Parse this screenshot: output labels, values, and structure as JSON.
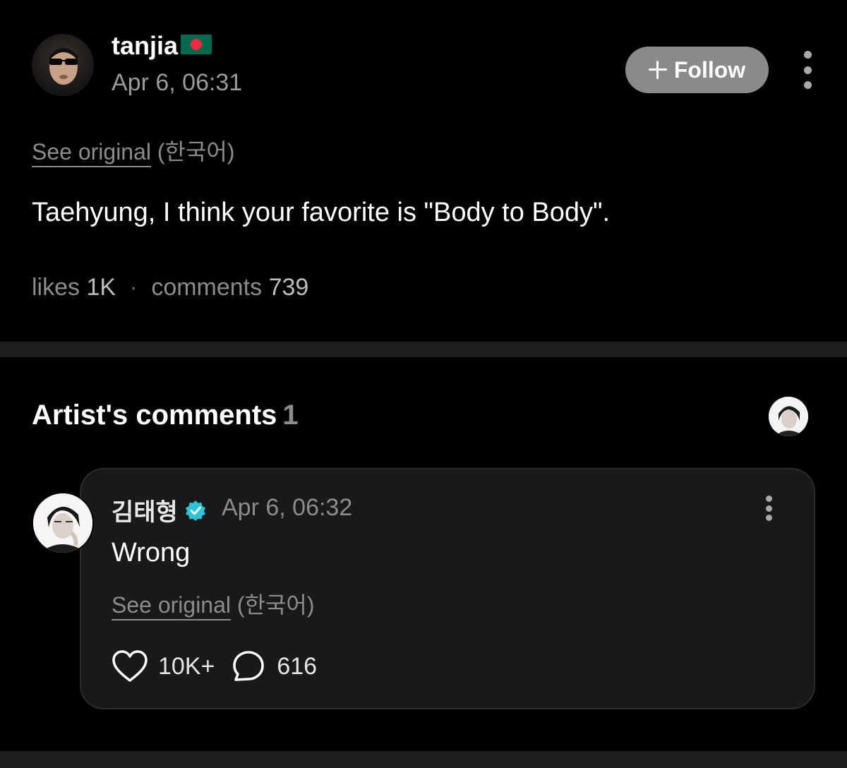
{
  "post": {
    "username": "tanjia",
    "flag": "bangladesh-flag-icon",
    "timestamp": "Apr 6, 06:31",
    "follow_label": "Follow",
    "see_original_label": "See original",
    "original_language": "(한국어)",
    "body": "Taehyung, I think your favorite is \"Body to Body\".",
    "stats": {
      "likes_label": "likes",
      "likes_value": "1K",
      "separator": "·",
      "comments_label": "comments",
      "comments_value": "739"
    }
  },
  "artist_comments": {
    "title": "Artist's comments",
    "count": "1",
    "comment": {
      "author": "김태형",
      "timestamp": "Apr 6, 06:32",
      "body": "Wrong",
      "see_original_label": "See original",
      "original_language": "(한국어)",
      "likes": "10K+",
      "replies": "616"
    }
  },
  "colors": {
    "background": "#000000",
    "card": "#191919",
    "follow_button": "#8a8a8a",
    "verified": "#2bc4d8",
    "muted_text": "#8c8c8c"
  }
}
